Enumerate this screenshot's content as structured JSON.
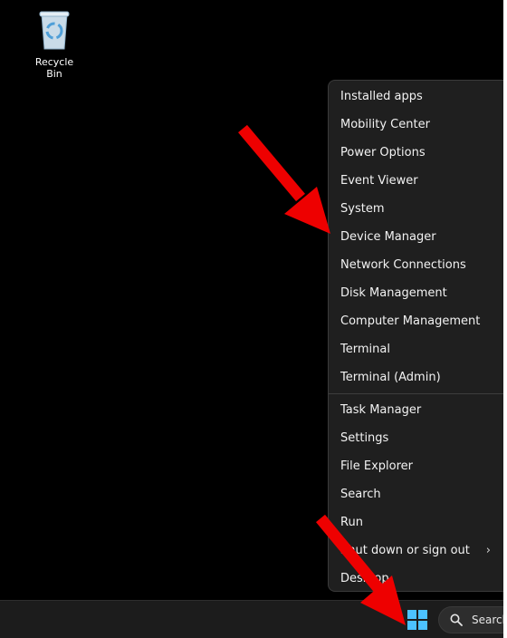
{
  "desktop": {
    "recycle_bin_label": "Recycle Bin"
  },
  "context_menu": {
    "group1": [
      "Installed apps",
      "Mobility Center",
      "Power Options",
      "Event Viewer",
      "System",
      "Device Manager",
      "Network Connections",
      "Disk Management",
      "Computer Management",
      "Terminal",
      "Terminal (Admin)"
    ],
    "group2": [
      "Task Manager",
      "Settings",
      "File Explorer",
      "Search",
      "Run",
      "Shut down or sign out",
      "Desktop"
    ],
    "submenu_indicator": "›"
  },
  "taskbar": {
    "search_label": "Search"
  },
  "colors": {
    "arrow": "#ee0000",
    "start_icon": "#4cc2ff",
    "recycle_icon": "#4f9fd8"
  },
  "icons": [
    "recycle-bin-icon",
    "windows-start-icon",
    "search-icon",
    "chevron-right-icon",
    "arrow-pointer-icon"
  ]
}
